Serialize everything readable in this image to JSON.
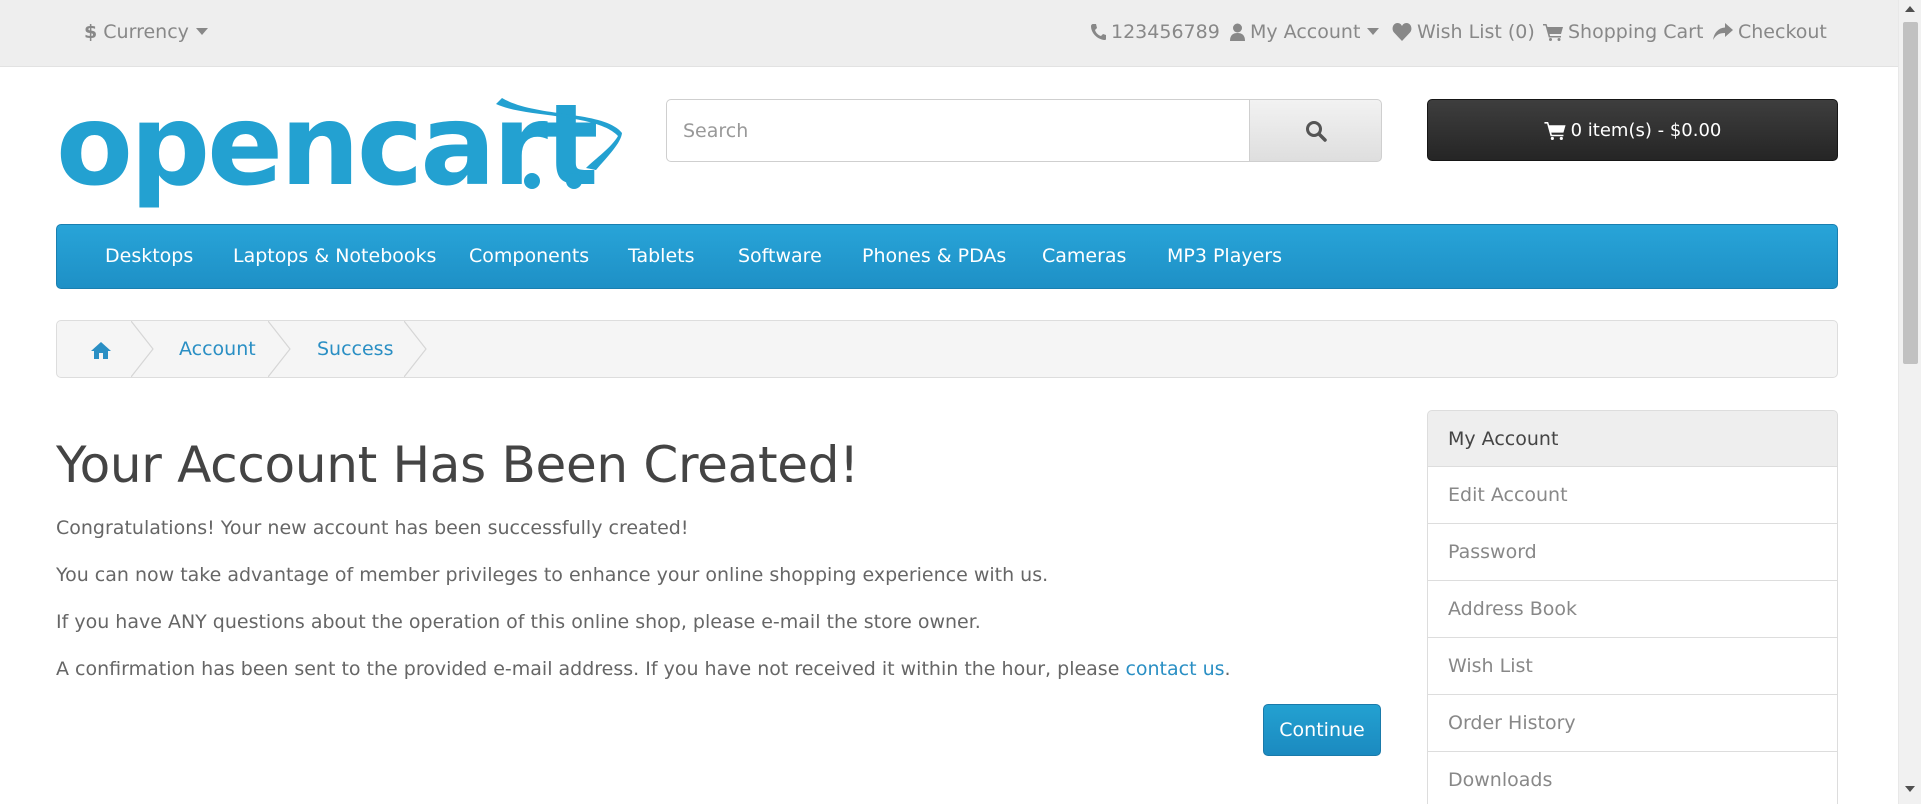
{
  "topbar": {
    "currency_symbol": "$",
    "currency_label": "Currency",
    "phone": "123456789",
    "my_account": "My Account",
    "wishlist": "Wish List (0)",
    "cart": "Shopping Cart",
    "checkout": "Checkout"
  },
  "logo": {
    "text": "opencart"
  },
  "search": {
    "placeholder": "Search"
  },
  "cart_button": {
    "label": "0 item(s) - $0.00"
  },
  "menu": {
    "items": [
      "Desktops",
      "Laptops & Notebooks",
      "Components",
      "Tablets",
      "Software",
      "Phones & PDAs",
      "Cameras",
      "MP3 Players"
    ]
  },
  "breadcrumb": {
    "account": "Account",
    "success": "Success"
  },
  "content": {
    "title": "Your Account Has Been Created!",
    "p1": "Congratulations! Your new account has been successfully created!",
    "p2": "You can now take advantage of member privileges to enhance your online shopping experience with us.",
    "p3": "If you have ANY questions about the operation of this online shop, please e-mail the store owner.",
    "p4_before": "A confirmation has been sent to the provided e-mail address. If you have not received it within the hour, please ",
    "p4_link": "contact us",
    "p4_after": ".",
    "continue_label": "Continue"
  },
  "sidebar": {
    "items": [
      "My Account",
      "Edit Account",
      "Password",
      "Address Book",
      "Wish List",
      "Order History",
      "Downloads"
    ]
  },
  "colors": {
    "brand_blue": "#23a1d1",
    "cart_dark": "#303030",
    "link": "#2a8fc4"
  }
}
